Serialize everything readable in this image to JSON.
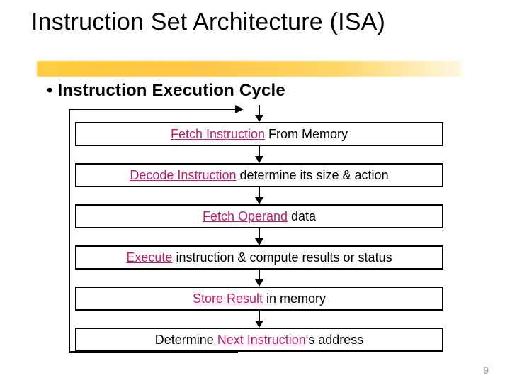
{
  "title": "Instruction Set Architecture (ISA)",
  "subtitle_bullet": "• Instruction Execution Cycle",
  "page_number": "9",
  "steps": [
    {
      "bold": "Fetch Instruction",
      "rest": " From Memory"
    },
    {
      "bold": "Decode Instruction",
      "rest": " determine its size & action"
    },
    {
      "bold": "Fetch Operand",
      "rest": " data"
    },
    {
      "bold": "Execute",
      "rest": " instruction & compute results or status"
    },
    {
      "bold": "Store Result",
      "rest": " in memory"
    },
    {
      "pre": "Determine ",
      "bold": "Next Instruction",
      "rest": "'s address"
    }
  ]
}
